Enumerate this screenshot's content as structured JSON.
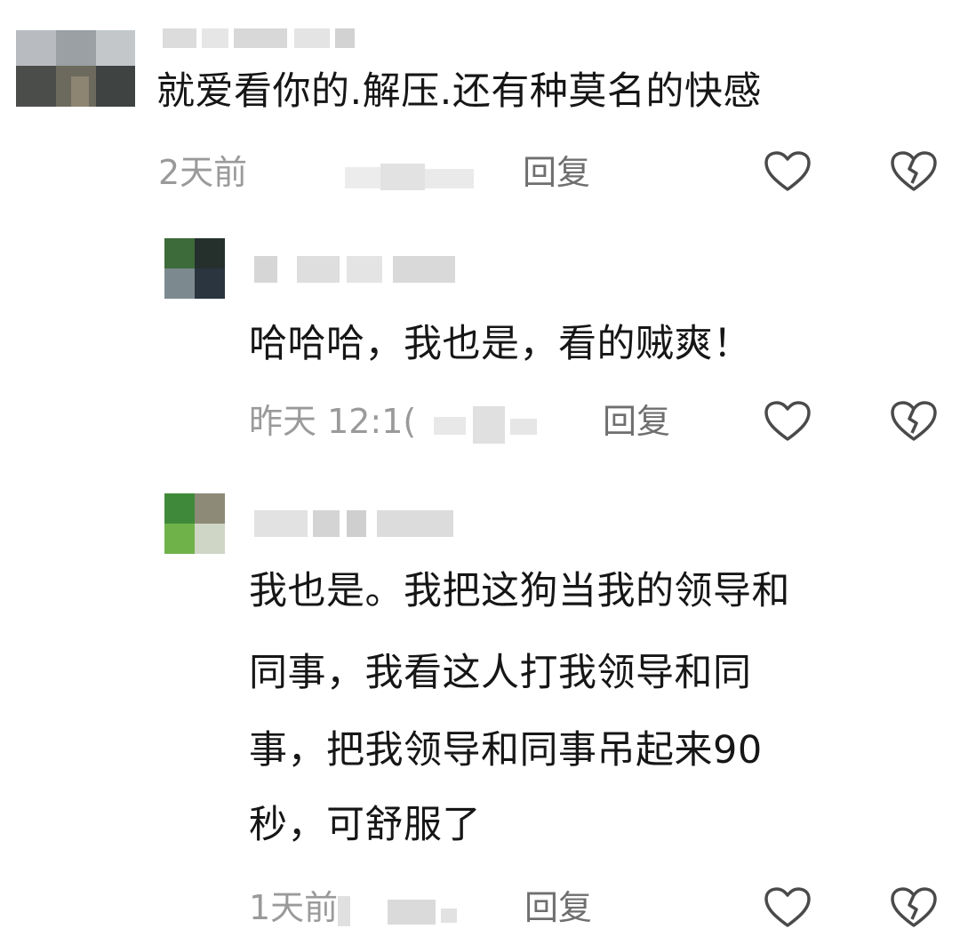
{
  "comments": [
    {
      "text": "就爱看你的.解压.还有种莫名的快感",
      "time": "2天前",
      "reply_label": "回复",
      "like_icon": "heart-outline-icon",
      "dislike_icon": "broken-heart-icon"
    },
    {
      "text": "哈哈哈，我也是，看的贼爽！",
      "time": "昨天 12:1(",
      "reply_label": "回复",
      "like_icon": "heart-outline-icon",
      "dislike_icon": "broken-heart-icon"
    },
    {
      "text_lines": [
        "我也是。我把这狗当我的领导和",
        "同事，我看这人打我领导和同",
        "事，把我领导和同事吊起来90",
        "秒，可舒服了"
      ],
      "time": "1天前",
      "reply_label": "回复",
      "like_icon": "heart-outline-icon",
      "dislike_icon": "broken-heart-icon"
    }
  ],
  "colors": {
    "text": "#161616",
    "meta": "#9a9a9a",
    "reply": "#6f6f6f",
    "icon": "#4a4a4a"
  }
}
